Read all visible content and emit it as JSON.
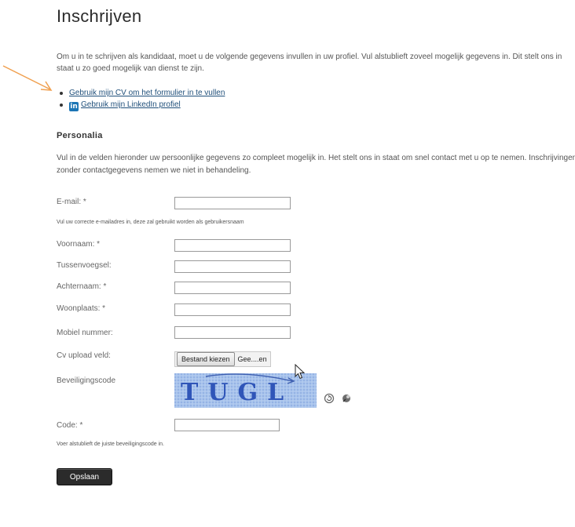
{
  "page": {
    "title": "Inschrijven",
    "intro": "Om u in te schrijven als kandidaat, moet u de volgende gegevens invullen in uw profiel. Vul alstublieft zoveel mogelijk gegevens in. Dit stelt ons in staat u zo goed mogelijk van dienst te zijn.",
    "links": {
      "cv": "Gebruik mijn CV om het formulier in te vullen",
      "linkedin": "Gebruik mijn LinkedIn profiel",
      "linkedin_icon": "in"
    }
  },
  "personalia": {
    "heading": "Personalia",
    "description": "Vul in de velden hieronder uw persoonlijke gegevens zo compleet mogelijk in. Het stelt ons in staat om snel contact met u op te nemen. Inschrijvingen zonder contactgegevens nemen we niet in behandeling."
  },
  "form": {
    "email": {
      "label": "E-mail: *",
      "value": "",
      "hint": "Vul uw correcte e-mailadres in, deze zal gebruikt worden als gebruikersnaam"
    },
    "voornaam": {
      "label": "Voornaam: *",
      "value": ""
    },
    "tussenvoegsel": {
      "label": "Tussenvoegsel:",
      "value": ""
    },
    "achternaam": {
      "label": "Achternaam: *",
      "value": ""
    },
    "woonplaats": {
      "label": "Woonplaats: *",
      "value": ""
    },
    "mobiel": {
      "label": "Mobiel nummer:",
      "value": ""
    },
    "cv_upload": {
      "label": "Cv upload veld:",
      "button": "Bestand kiezen",
      "filename": "Gee....en"
    },
    "beveiliging": {
      "label": "Beveiligingscode",
      "captcha_text": "TUGL",
      "refresh_icon": "refresh-icon",
      "audio_icon": "audio-icon"
    },
    "code": {
      "label": "Code: *",
      "value": "",
      "hint": "Voer alstublieft de juiste beveiligingscode in."
    },
    "submit": "Opslaan"
  },
  "colors": {
    "link": "#1f4f7a",
    "annotation_arrow": "#f0a050",
    "submit_bg": "#2b2b2b",
    "linkedin": "#1b75b5"
  }
}
